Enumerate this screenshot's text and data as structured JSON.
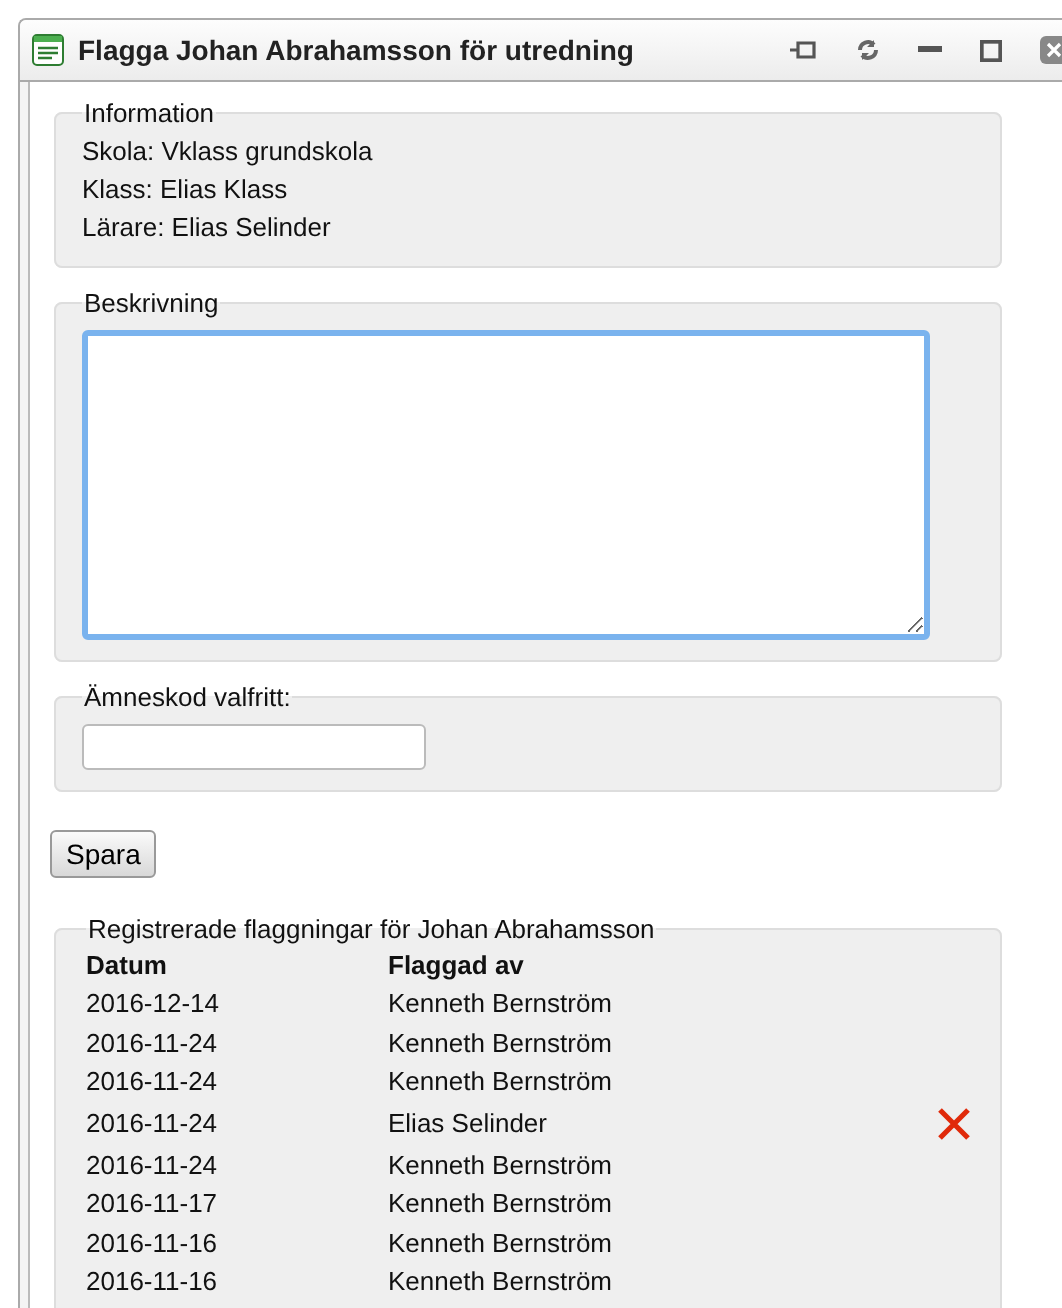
{
  "window": {
    "title": "Flagga Johan Abrahamsson för utredning"
  },
  "information": {
    "legend": "Information",
    "lines": [
      "Skola: Vklass grundskola",
      "Klass: Elias Klass",
      "Lärare: Elias Selinder"
    ]
  },
  "description": {
    "legend": "Beskrivning",
    "focused": true
  },
  "subject_code": {
    "legend": "Ämneskod valfritt:"
  },
  "save_button": "Spara",
  "flags": {
    "legend": "Registrerade flaggningar för Johan Abrahamsson",
    "columns": [
      "Datum",
      "Flaggad av"
    ],
    "rows": [
      {
        "date": "2016-12-14",
        "by": "Kenneth Bernström",
        "deletable": false
      },
      {
        "date": "2016-11-24",
        "by": "Kenneth Bernström",
        "deletable": false
      },
      {
        "date": "2016-11-24",
        "by": "Kenneth Bernström",
        "deletable": false
      },
      {
        "date": "2016-11-24",
        "by": "Elias Selinder",
        "deletable": true
      },
      {
        "date": "2016-11-24",
        "by": "Kenneth Bernström",
        "deletable": false
      },
      {
        "date": "2016-11-17",
        "by": "Kenneth Bernström",
        "deletable": false
      },
      {
        "date": "2016-11-16",
        "by": "Kenneth Bernström",
        "deletable": false
      },
      {
        "date": "2016-11-16",
        "by": "Kenneth Bernström",
        "deletable": false
      }
    ]
  }
}
